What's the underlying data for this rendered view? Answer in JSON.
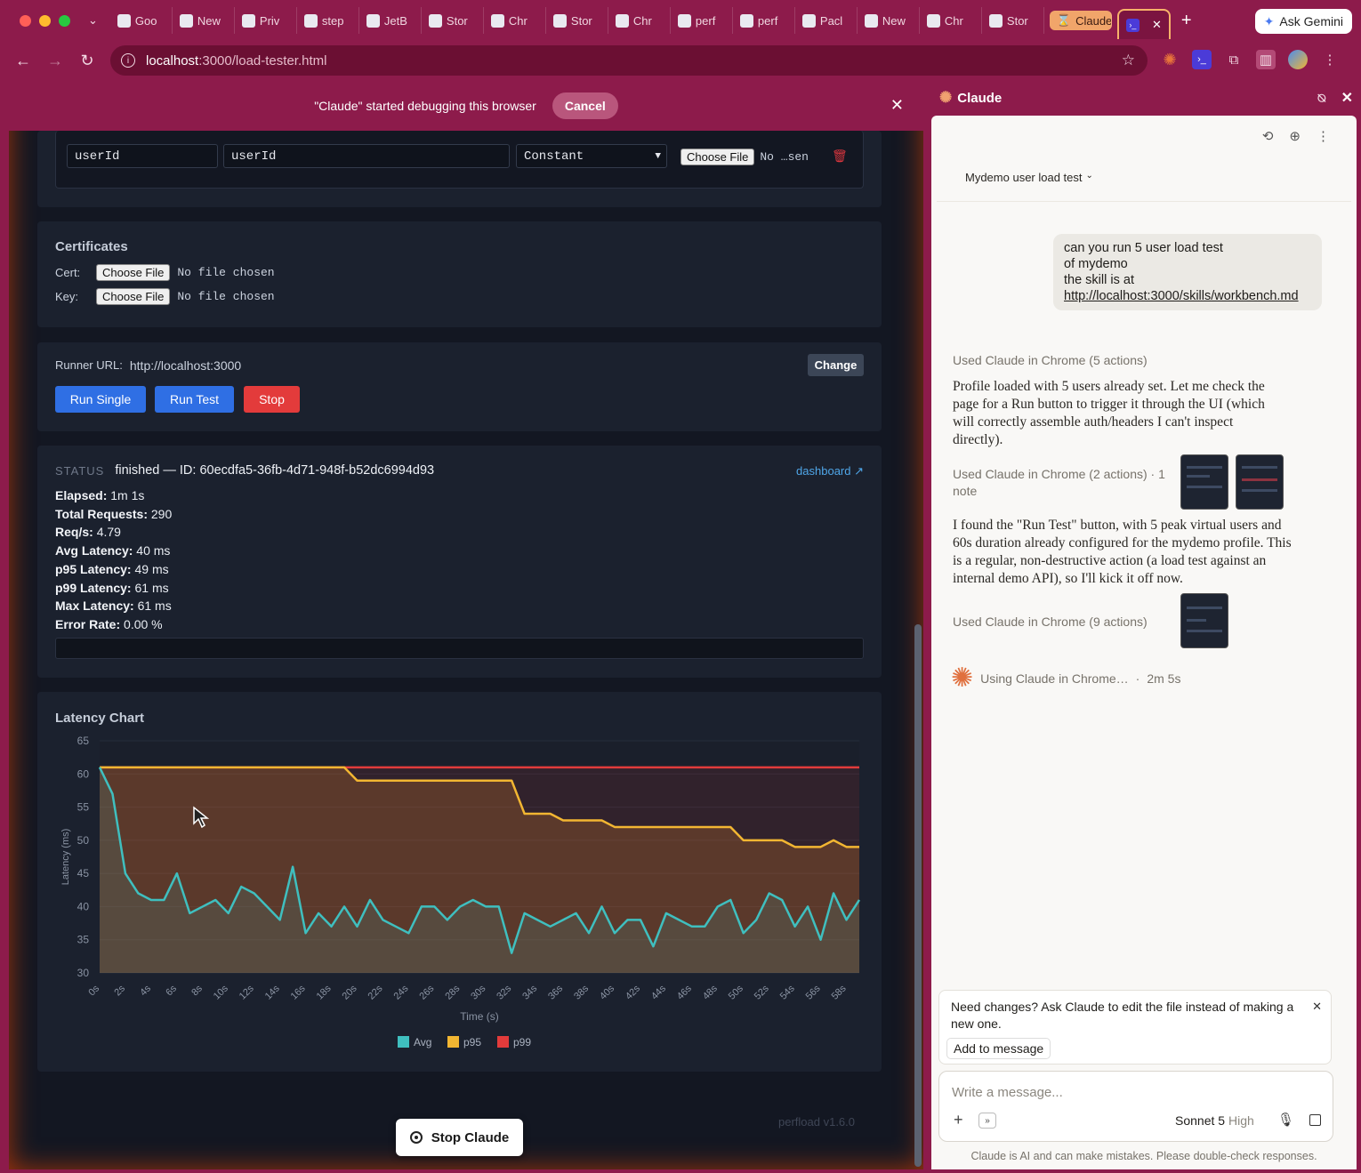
{
  "browser": {
    "tabs": [
      "Goo",
      "New",
      "Priv",
      "step",
      "JetB",
      "Stor",
      "Chr",
      "Stor",
      "Chr",
      "perf",
      "perf",
      "Pacl",
      "New",
      "Chr",
      "Stor"
    ],
    "claude_tab": "Claude",
    "gemini_label": "Ask Gemini",
    "url_host": "localhost",
    "url_rest": ":3000/load-tester.html"
  },
  "debug": {
    "message": "\"Claude\" started debugging this browser",
    "cancel": "Cancel"
  },
  "vars": {
    "key": "userId",
    "value": "userId",
    "type": "Constant",
    "file_btn": "Choose File",
    "file_status": "No …sen"
  },
  "certs": {
    "title": "Certificates",
    "cert_label": "Cert:",
    "key_label": "Key:",
    "file_btn": "Choose File",
    "none": "No file chosen"
  },
  "runner": {
    "label": "Runner URL:",
    "url": "http://localhost:3000",
    "change": "Change",
    "run_single": "Run Single",
    "run_test": "Run Test",
    "stop": "Stop"
  },
  "status": {
    "label": "STATUS",
    "text": "finished — ID: 60ecdfa5-36fb-4d71-948f-b52dc6994d93",
    "dashboard": "dashboard ↗",
    "stats": [
      {
        "k": "Elapsed:",
        "v": "1m 1s"
      },
      {
        "k": "Total Requests:",
        "v": "290"
      },
      {
        "k": "Req/s:",
        "v": "4.79"
      },
      {
        "k": "Avg Latency:",
        "v": "40 ms"
      },
      {
        "k": "p95 Latency:",
        "v": "49 ms"
      },
      {
        "k": "p99 Latency:",
        "v": "61 ms"
      },
      {
        "k": "Max Latency:",
        "v": "61 ms"
      },
      {
        "k": "Error Rate:",
        "v": "0.00 %"
      }
    ]
  },
  "chart_data": {
    "type": "line",
    "title": "Latency Chart",
    "xlabel": "Time (s)",
    "ylabel": "Latency (ms)",
    "ylim": [
      30,
      65
    ],
    "yticks": [
      30,
      35,
      40,
      45,
      50,
      55,
      60,
      65
    ],
    "x": [
      0,
      1,
      2,
      3,
      4,
      5,
      6,
      7,
      8,
      9,
      10,
      11,
      12,
      13,
      14,
      15,
      16,
      17,
      18,
      19,
      20,
      21,
      22,
      23,
      24,
      25,
      26,
      27,
      28,
      29,
      30,
      31,
      32,
      33,
      34,
      35,
      36,
      37,
      38,
      39,
      40,
      41,
      42,
      43,
      44,
      45,
      46,
      47,
      48,
      49,
      50,
      51,
      52,
      53,
      54,
      55,
      56,
      57,
      58,
      59
    ],
    "xtick_labels": [
      "0s",
      "2s",
      "4s",
      "6s",
      "8s",
      "10s",
      "12s",
      "14s",
      "16s",
      "18s",
      "20s",
      "22s",
      "24s",
      "26s",
      "28s",
      "30s",
      "32s",
      "34s",
      "36s",
      "38s",
      "40s",
      "42s",
      "44s",
      "46s",
      "48s",
      "50s",
      "52s",
      "54s",
      "56s",
      "58s"
    ],
    "legend": "bottom",
    "series": [
      {
        "name": "Avg",
        "color": "#3fbfbf",
        "values": [
          61,
          57,
          45,
          42,
          41,
          41,
          45,
          39,
          40,
          41,
          39,
          43,
          42,
          40,
          38,
          46,
          36,
          39,
          37,
          40,
          37,
          41,
          38,
          37,
          36,
          40,
          40,
          38,
          40,
          41,
          40,
          40,
          33,
          39,
          38,
          37,
          38,
          39,
          36,
          40,
          36,
          38,
          38,
          34,
          39,
          38,
          37,
          37,
          40,
          41,
          36,
          38,
          42,
          41,
          37,
          40,
          35,
          42,
          38,
          41
        ]
      },
      {
        "name": "p95",
        "color": "#f2b632",
        "values": [
          61,
          61,
          61,
          61,
          61,
          61,
          61,
          61,
          61,
          61,
          61,
          61,
          61,
          61,
          61,
          61,
          61,
          61,
          61,
          61,
          59,
          59,
          59,
          59,
          59,
          59,
          59,
          59,
          59,
          59,
          59,
          59,
          59,
          54,
          54,
          54,
          53,
          53,
          53,
          53,
          52,
          52,
          52,
          52,
          52,
          52,
          52,
          52,
          52,
          52,
          50,
          50,
          50,
          50,
          49,
          49,
          49,
          50,
          49,
          49
        ]
      },
      {
        "name": "p99",
        "color": "#e23b3b",
        "values": [
          61,
          61,
          61,
          61,
          61,
          61,
          61,
          61,
          61,
          61,
          61,
          61,
          61,
          61,
          61,
          61,
          61,
          61,
          61,
          61,
          61,
          61,
          61,
          61,
          61,
          61,
          61,
          61,
          61,
          61,
          61,
          61,
          61,
          61,
          61,
          61,
          61,
          61,
          61,
          61,
          61,
          61,
          61,
          61,
          61,
          61,
          61,
          61,
          61,
          61,
          61,
          61,
          61,
          61,
          61,
          61,
          61,
          61,
          61,
          61
        ]
      }
    ]
  },
  "footer": {
    "version": "perfload v1.6.0",
    "stop_claude": "Stop Claude"
  },
  "claude": {
    "title": "Claude",
    "session": "Mydemo user load test",
    "user_msg": [
      "can you run 5 user load test",
      "of mydemo",
      "the skill is at"
    ],
    "user_link": "http://localhost:3000/skills/workbench.md",
    "used1": "Used Claude in Chrome (5 actions)",
    "msg1": "Profile loaded with 5 users already set. Let me check the page for a Run button to trigger it through the UI (which will correctly assemble auth/headers I can't inspect directly).",
    "used2": "Used Claude in Chrome (2 actions) · 1 note",
    "msg2": "I found the \"Run Test\" button, with 5 peak virtual users and 60s duration already configured for the mydemo profile. This is a regular, non-destructive action (a load test against an internal demo API), so I'll kick it off now.",
    "used3": "Used Claude in Chrome (9 actions)",
    "working": "Using Claude in Chrome…",
    "elapsed": "2m 5s",
    "suggestion": "Need changes? Ask Claude to edit the file instead of making a new one.",
    "add_to_message": "Add to message",
    "placeholder": "Write a message...",
    "model": "Sonnet 5",
    "effort": "High",
    "disclaimer": "Claude is AI and can make mistakes. Please double-check responses."
  }
}
